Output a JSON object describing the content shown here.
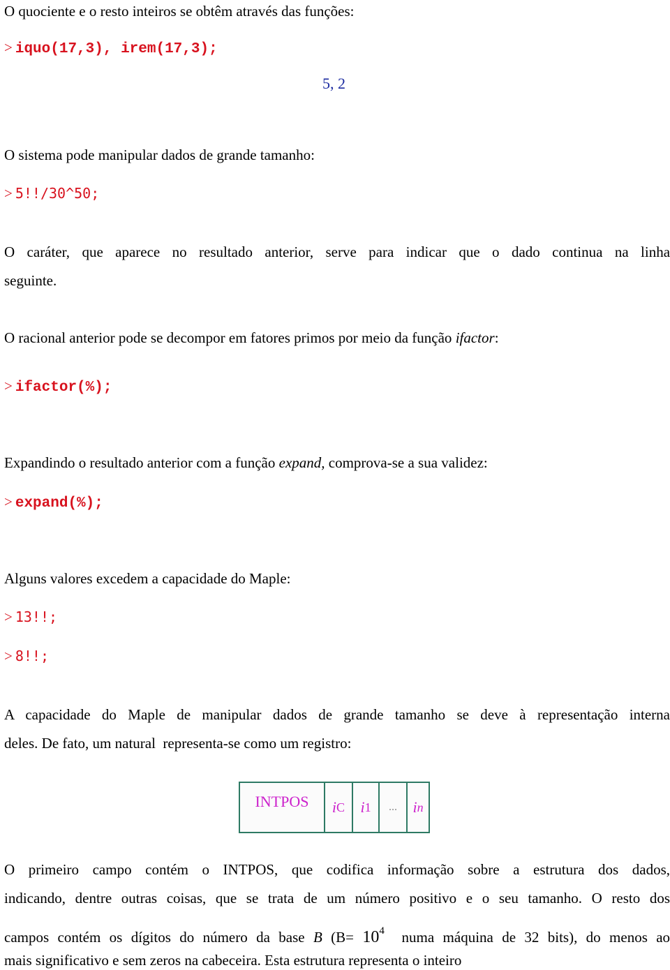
{
  "paragraphs": {
    "p1": "O quociente e o resto inteiros se obtêm através das funções:",
    "p2": "O sistema pode manipular dados de grande tamanho:",
    "p3_line1": "O caráter, que aparece no resultado anterior, serve para indicar que o dado continua na linha",
    "p3_line2": "seguinte.",
    "p4_prefix": "O racional anterior pode se decompor em fatores primos por meio da função ",
    "p4_func": "ifactor",
    "p4_suffix": ":",
    "p5_prefix": "Expandindo o resultado anterior com a função ",
    "p5_func": "expand,",
    "p5_suffix": " comprova-se a sua validez:",
    "p6": "Alguns valores excedem a capacidade do Maple:",
    "p7_line1": "A capacidade do Maple de manipular dados de grande tamanho se deve à representação interna",
    "p7_line2": "deles. De fato, um natural  representa-se como um registro:",
    "p8_line1": "O primeiro campo contém o INTPOS, que codifica informação sobre a estrutura dos dados,",
    "p8_line2": "indicando, dentre outras coisas, que se trata de um número positivo e o seu tamanho. O resto dos",
    "p8_line3_a": "campos contém os dígitos do número da base ",
    "p8_line3_b": "B",
    "p8_line3_c": " (B= ",
    "p8_line3_base": "10",
    "p8_line3_exp": "4",
    "p8_line3_d": "  numa máquina de 32 bits), do menos ao",
    "p8_line4": "mais significativo e sem zeros na cabeceira. Esta estrutura representa o inteiro"
  },
  "commands": {
    "prompt": ">",
    "c1": "iquo(17,3), irem(17,3);",
    "c2": "5!!/30^50;",
    "c3": "ifactor(%);",
    "c4": "expand(%);",
    "c5": "13!!;",
    "c6": "8!!;"
  },
  "outputs": {
    "o1": "5, 2"
  },
  "register": {
    "header": "INTPOS",
    "cells": [
      {
        "base": "i",
        "sub": "C"
      },
      {
        "base": "i",
        "sub": "1"
      },
      {
        "ellipsis": "..."
      },
      {
        "base": "i",
        "sub": "n"
      }
    ]
  },
  "colors": {
    "command": "#d8121e",
    "output": "#1a2aa0",
    "register_text": "#cc22cc",
    "register_border": "#2e7a64"
  }
}
